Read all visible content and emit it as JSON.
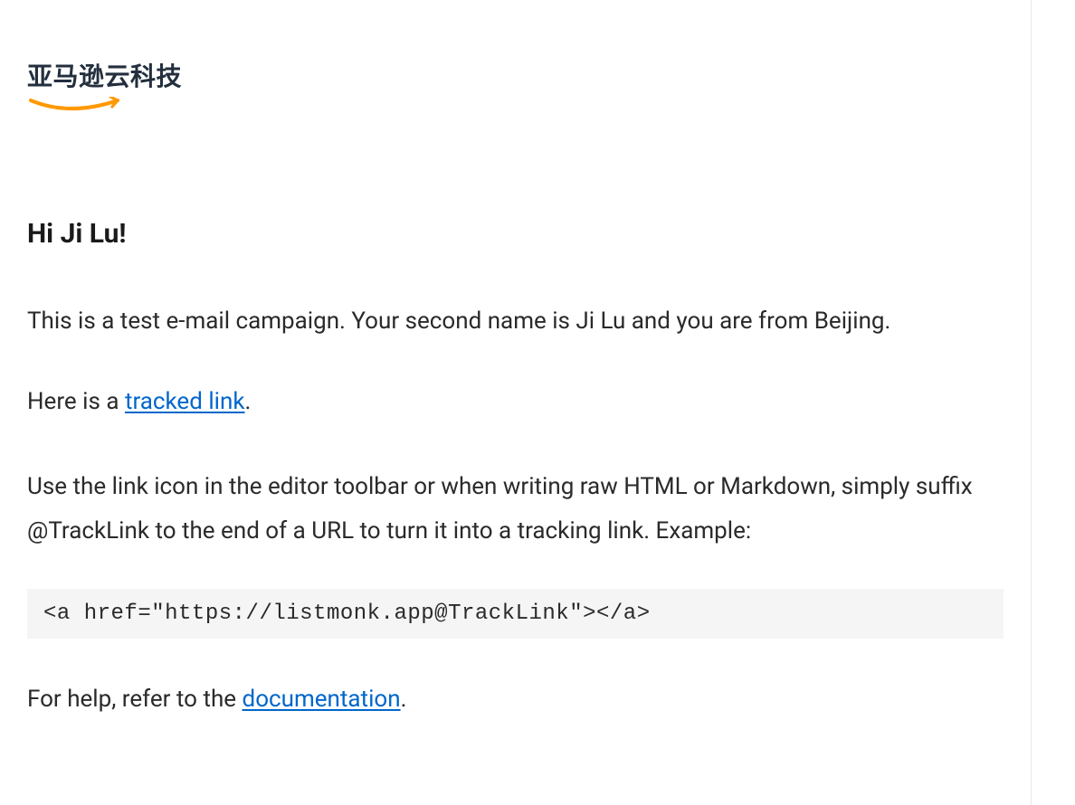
{
  "logo": {
    "text": "亚马逊云科技"
  },
  "greeting": "Hi Ji Lu!",
  "paragraph1": "This is a test e-mail campaign. Your second name is Ji Lu and you are from Beijing.",
  "paragraph2_prefix": "Here is a ",
  "paragraph2_link": "tracked link",
  "paragraph2_suffix": ".",
  "paragraph3": "Use the link icon in the editor toolbar or when writing raw HTML or Markdown, simply suffix @TrackLink to the end of a URL to turn it into a tracking link. Example:",
  "code_example": "<a href=\"https://listmonk.app@TrackLink\"></a>",
  "help_prefix": "For help, refer to the ",
  "help_link": "documentation",
  "help_suffix": "."
}
